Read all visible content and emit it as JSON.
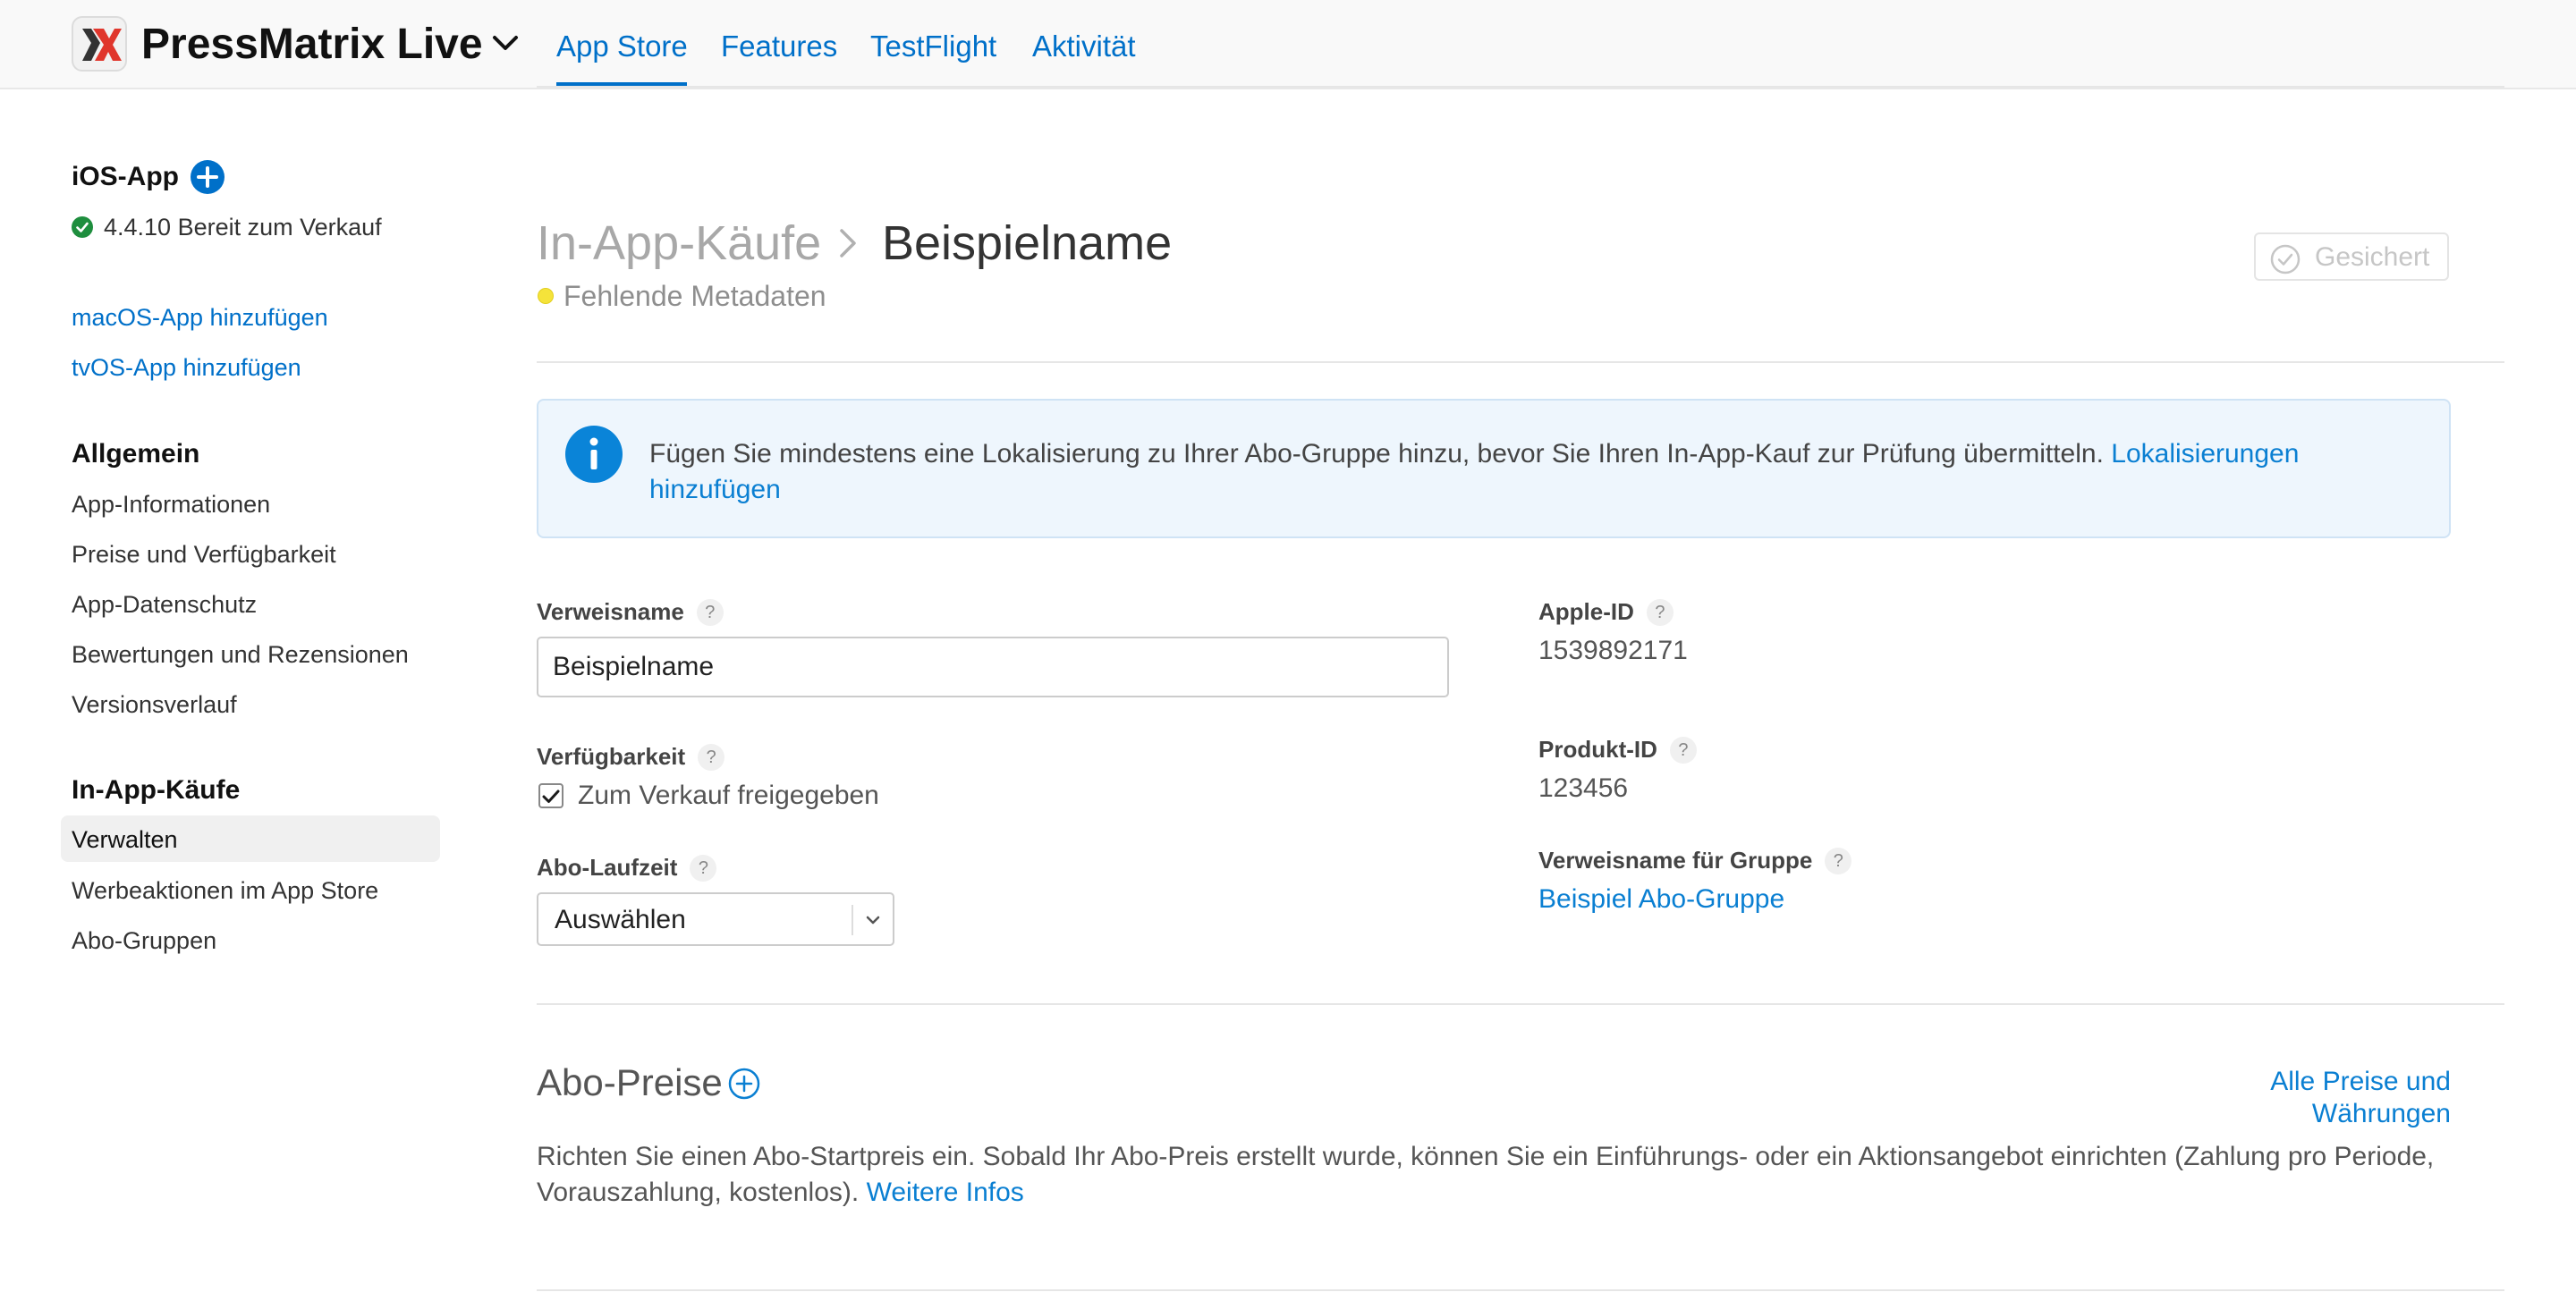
{
  "header": {
    "app_name": "PressMatrix Live",
    "tabs": [
      {
        "label": "App Store",
        "active": true
      },
      {
        "label": "Features",
        "active": false
      },
      {
        "label": "TestFlight",
        "active": false
      },
      {
        "label": "Aktivität",
        "active": false
      }
    ]
  },
  "sidebar": {
    "ios_heading": "iOS-App",
    "ios_version_status": "4.4.10 Bereit zum Verkauf",
    "add_macos": "macOS-App hinzufügen",
    "add_tvos": "tvOS-App hinzufügen",
    "general_heading": "Allgemein",
    "general_items": [
      "App-Informationen",
      "Preise und Verfügbarkeit",
      "App-Datenschutz",
      "Bewertungen und Rezensionen",
      "Versionsverlauf"
    ],
    "iap_heading": "In-App-Käufe",
    "iap_items": [
      {
        "label": "Verwalten",
        "active": true
      },
      {
        "label": "Werbeaktionen im App Store",
        "active": false
      },
      {
        "label": "Abo-Gruppen",
        "active": false
      }
    ]
  },
  "main": {
    "breadcrumb_parent": "In-App-Käufe",
    "breadcrumb_current": "Beispielname",
    "status_text": "Fehlende Metadaten",
    "saved_label": "Gesichert",
    "info_text": "Fügen Sie mindestens eine Lokalisierung zu Ihrer Abo-Gruppe hinzu, bevor Sie Ihren In-App-Kauf zur Prüfung übermitteln.",
    "info_link": "Lokalisierungen hinzufügen",
    "fields": {
      "reference_name_label": "Verweisname",
      "reference_name_value": "Beispielname",
      "availability_label": "Verfügbarkeit",
      "availability_checkbox": "Zum Verkauf freigegeben",
      "duration_label": "Abo-Laufzeit",
      "duration_value": "Auswählen",
      "apple_id_label": "Apple-ID",
      "apple_id_value": "1539892171",
      "product_id_label": "Produkt-ID",
      "product_id_value": "123456",
      "group_ref_label": "Verweisname für Gruppe",
      "group_ref_value": "Beispiel Abo-Gruppe"
    },
    "help_glyph": "?",
    "pricing": {
      "title": "Abo-Preise",
      "all_prices_link": "Alle Preise und Währungen",
      "description": "Richten Sie einen Abo-Startpreis ein. Sobald Ihr Abo-Preis erstellt wurde, können Sie ein Einführungs- oder ein Aktionsangebot einrichten (Zahlung pro Periode, Vorauszahlung, kostenlos).",
      "more_info_link": "Weitere Infos"
    }
  },
  "colors": {
    "accent": "#0070c9",
    "status_warning": "#f5e33a",
    "status_ok": "#1e8e3e"
  }
}
